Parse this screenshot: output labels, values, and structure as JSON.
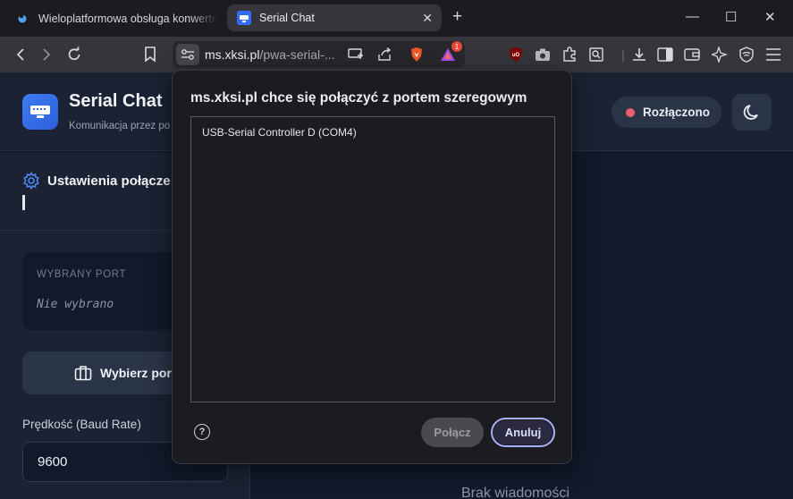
{
  "browser": {
    "tabs": [
      {
        "title": "Wieloplatformowa obsługa konwertera",
        "active": false
      },
      {
        "title": "Serial Chat",
        "active": true
      }
    ],
    "url": {
      "host": "ms.xksi.pl",
      "path": "/pwa-serial-..."
    },
    "extension_badge": "1",
    "icons": [
      "back-icon",
      "forward-icon",
      "reload-icon",
      "bookmark-icon",
      "site-settings-icon",
      "install-icon",
      "share-icon",
      "brave-shields-icon",
      "brave-rewards-icon",
      "ublock-icon",
      "camera-icon",
      "extensions-icon",
      "reader-icon",
      "download-icon",
      "sidebar-icon",
      "wallet-icon",
      "leo-icon",
      "vpn-icon",
      "menu-icon"
    ]
  },
  "app": {
    "title": "Serial Chat",
    "subtitle": "Komunikacja przez po",
    "status": "Rozłączono",
    "status_color": "#f05c6a",
    "settings_title": "Ustawienia połącze",
    "port_label": "WYBRANY PORT",
    "port_value": "Nie wybrano",
    "pick_port_button": "Wybierz por",
    "baud_label": "Prędkość (Baud Rate)",
    "baud_value": "9600",
    "empty_messages": "Brak wiadomości"
  },
  "dialog": {
    "title": "ms.xksi.pl chce się połączyć z portem szeregowym",
    "ports": [
      "USB-Serial Controller D (COM4)"
    ],
    "connect_button": "Połącz",
    "cancel_button": "Anuluj",
    "help_icon": "?"
  },
  "colors": {
    "accent": "#2f6df6",
    "focus_ring": "#a7b0ff",
    "page_bg": "#111a2b"
  }
}
